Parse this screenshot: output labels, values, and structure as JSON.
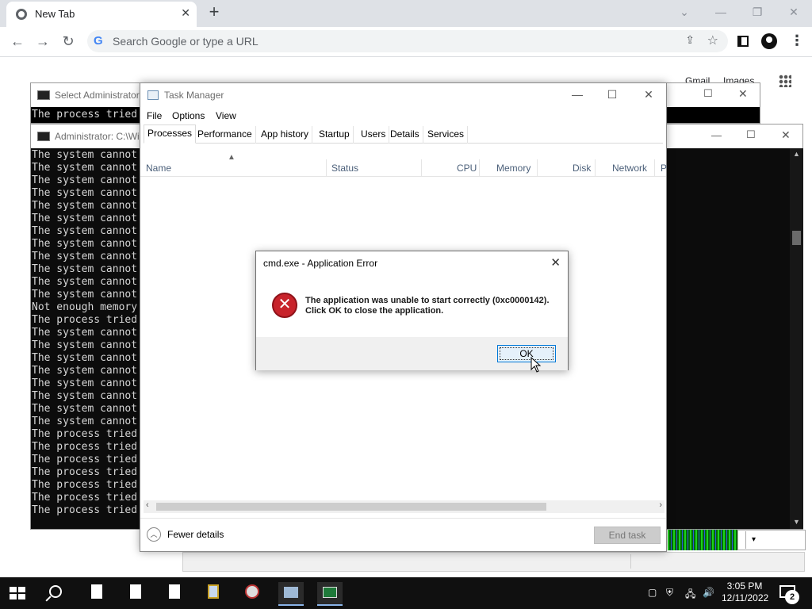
{
  "browser": {
    "tab_title": "New Tab",
    "tab_close": "✕",
    "new_tab": "+",
    "omnibox_placeholder": "Search Google or type a URL",
    "gmail": "Gmail",
    "images": "Images"
  },
  "console_back": {
    "title": "Select Administrator",
    "lines": [
      "The process tried"
    ]
  },
  "console_front": {
    "title": "Administrator: C:\\Wi",
    "lines": [
      "The system cannot",
      "The system cannot",
      "The system cannot",
      "The system cannot",
      "The system cannot",
      "The system cannot",
      "The system cannot",
      "The system cannot",
      "The system cannot",
      "The system cannot",
      "The system cannot",
      "The system cannot",
      "Not enough memory",
      "The process tried",
      "The system cannot",
      "The system cannot",
      "The system cannot",
      "The system cannot",
      "The system cannot",
      "The system cannot",
      "The system cannot",
      "The system cannot",
      "The process tried",
      "The process tried",
      "The process tried",
      "The process tried",
      "The process tried",
      "The process tried",
      "The process tried"
    ]
  },
  "task_manager": {
    "title": "Task Manager",
    "menu": [
      "File",
      "Options",
      "View"
    ],
    "tabs": [
      "Processes",
      "Performance",
      "App history",
      "Startup",
      "Users",
      "Details",
      "Services"
    ],
    "active_tab": "Processes",
    "columns": [
      "Name",
      "Status",
      "CPU",
      "Memory",
      "Disk",
      "Network",
      "P"
    ],
    "fewer_details": "Fewer details",
    "end_task": "End task"
  },
  "error_dialog": {
    "title": "cmd.exe - Application Error",
    "message_line1": "The application was unable to start correctly (0xc0000142).",
    "message_line2": "Click OK to close the application.",
    "ok_label": "OK",
    "icon": "error-icon"
  },
  "taskbar": {
    "time": "3:05 PM",
    "date": "12/11/2022",
    "notification_count": "2",
    "pinned_apps": [
      "file-icon",
      "file-icon",
      "file-icon",
      "notepad-icon",
      "compass-icon",
      "task-manager-icon",
      "console-icon"
    ]
  },
  "colors": {
    "console_bg": "#0c0c0c",
    "error_red": "#c8232b",
    "taskbar_bg": "#101010",
    "ok_border": "#0078d7"
  }
}
